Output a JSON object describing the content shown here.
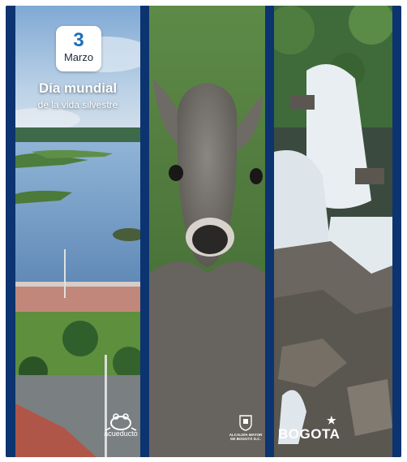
{
  "event": {
    "day": "3",
    "month": "Marzo",
    "title": "Día mundial",
    "subtitle": "de la vida silvestre"
  },
  "logos": {
    "acueducto": "acueducto",
    "alcaldia": "ALCALDÍA MAYOR DE BOGOTÁ D.C.",
    "bogota": "BOGOTA"
  },
  "colors": {
    "frame_blue": "#0d3a78",
    "date_blue": "#1f6fb5"
  }
}
